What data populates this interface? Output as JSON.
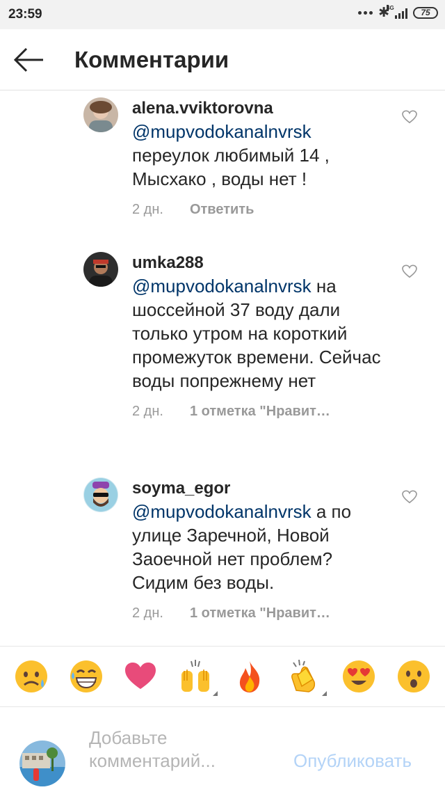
{
  "status_bar": {
    "time": "23:59",
    "network": "4G",
    "battery": "75"
  },
  "header": {
    "title": "Комментарии",
    "back_icon": "arrow-left-icon"
  },
  "comments": [
    {
      "username": "alena.vviktorovna",
      "mention": "@mupvodokanalnvrsk",
      "text": "переулок любимый 14 , Мысхако , воды нет !",
      "time": "2 дн.",
      "action": "Ответить"
    },
    {
      "username": "umka288",
      "mention": "@mupvodokanalnvrsk",
      "text": "на шоссейной 37 воду дали только утром на короткий промежуток времени. Сейчас воды попрежнему нет",
      "time": "2 дн.",
      "action": "1 отметка \"Нравит…"
    },
    {
      "username": "soyma_egor",
      "mention": "@mupvodokanalnvrsk",
      "text": "а по улице Заречной, Новой Заоечной нет проблем? Сидим без воды.",
      "time": "2 дн.",
      "action": "1 отметка \"Нравит…"
    }
  ],
  "emoji_bar": [
    "sad-tear-emoji",
    "grin-sweat-emoji",
    "heart-emoji",
    "raised-hands-emoji",
    "fire-emoji",
    "clapping-hands-emoji",
    "heart-eyes-emoji",
    "surprised-emoji"
  ],
  "compose": {
    "placeholder": "Добавьте комментарий...",
    "publish_label": "Опубликовать"
  },
  "colors": {
    "mention": "#003569",
    "meta": "#999999",
    "publish_disabled": "#b3d3f7"
  }
}
